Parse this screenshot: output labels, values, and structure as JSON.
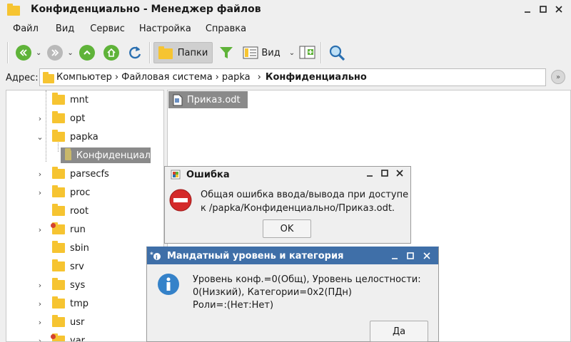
{
  "window": {
    "title": "Конфиденциально - Менеджер файлов"
  },
  "menu": [
    "Файл",
    "Вид",
    "Сервис",
    "Настройка",
    "Справка"
  ],
  "toolbar": {
    "folders_label": "Папки",
    "view_label": "Вид"
  },
  "address": {
    "label": "Адрес:",
    "crumbs": [
      "Компьютер",
      "Файловая система",
      "papka",
      "Конфиденциально"
    ]
  },
  "tree": {
    "items": [
      {
        "name": "mnt",
        "arrow": ""
      },
      {
        "name": "opt",
        "arrow": "›"
      },
      {
        "name": "papka",
        "arrow": "⌄"
      },
      {
        "name": "Конфиденциал",
        "arrow": ""
      },
      {
        "name": "parsecfs",
        "arrow": "›"
      },
      {
        "name": "proc",
        "arrow": "›"
      },
      {
        "name": "root",
        "arrow": ""
      },
      {
        "name": "run",
        "arrow": "›"
      },
      {
        "name": "sbin",
        "arrow": ""
      },
      {
        "name": "srv",
        "arrow": ""
      },
      {
        "name": "sys",
        "arrow": "›"
      },
      {
        "name": "tmp",
        "arrow": "›"
      },
      {
        "name": "usr",
        "arrow": "›"
      },
      {
        "name": "var",
        "arrow": "›"
      }
    ]
  },
  "files": [
    {
      "name": "Приказ.odt"
    }
  ],
  "error_dialog": {
    "title": "Ошибка",
    "line1": "Общая ошибка ввода/вывода при доступе",
    "line2": "к /papka/Конфиденциально/Приказ.odt.",
    "ok_label": "OK"
  },
  "info_dialog": {
    "title": "Мандатный уровень и категория",
    "line1": "Уровень конф.=0(Общ), Уровень целостности:",
    "line2": "0(Низкий), Категории=0x2(ПДн)",
    "line3": "Роли=:(Нет:Нет)",
    "yes_label": "Да"
  }
}
